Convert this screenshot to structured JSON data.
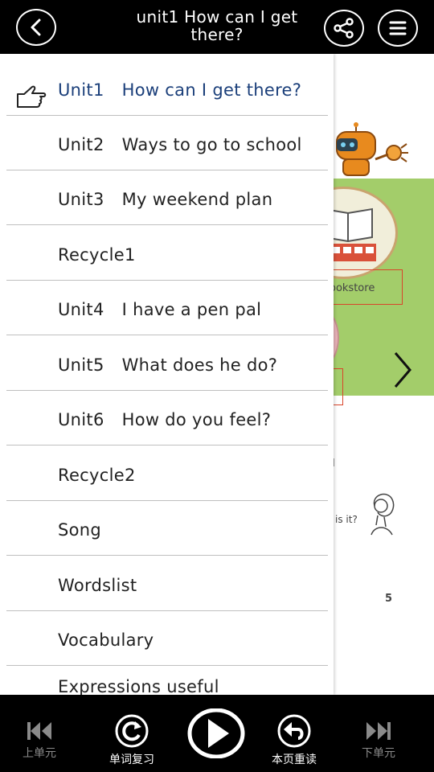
{
  "header": {
    "title": "unit1  How can I get there?"
  },
  "page": {
    "bookstore_label": "ookstore",
    "mark_text": "I",
    "question_text": "is it?",
    "page_number": "5"
  },
  "menu": {
    "items": [
      {
        "unit": "Unit1",
        "title": "How can I get there?"
      },
      {
        "unit": "Unit2",
        "title": "Ways to go to school"
      },
      {
        "unit": "Unit3",
        "title": "My weekend plan"
      },
      {
        "unit": "",
        "title": "Recycle1"
      },
      {
        "unit": "Unit4",
        "title": "I have a pen pal"
      },
      {
        "unit": "Unit5",
        "title": "What does he do?"
      },
      {
        "unit": "Unit6",
        "title": "How do you feel?"
      },
      {
        "unit": "",
        "title": "Recycle2"
      },
      {
        "unit": "",
        "title": "Song"
      },
      {
        "unit": "",
        "title": "Wordslist"
      },
      {
        "unit": "",
        "title": "Vocabulary"
      },
      {
        "unit": "",
        "title": "Expressions   useful"
      }
    ]
  },
  "footer": {
    "prev_unit": "上单元",
    "word_review": "单词复习",
    "reread_page": "本页重读",
    "next_unit": "下单元"
  },
  "colors": {
    "active_item": "#1b3f7a",
    "green_panel": "#a3cd6a"
  }
}
